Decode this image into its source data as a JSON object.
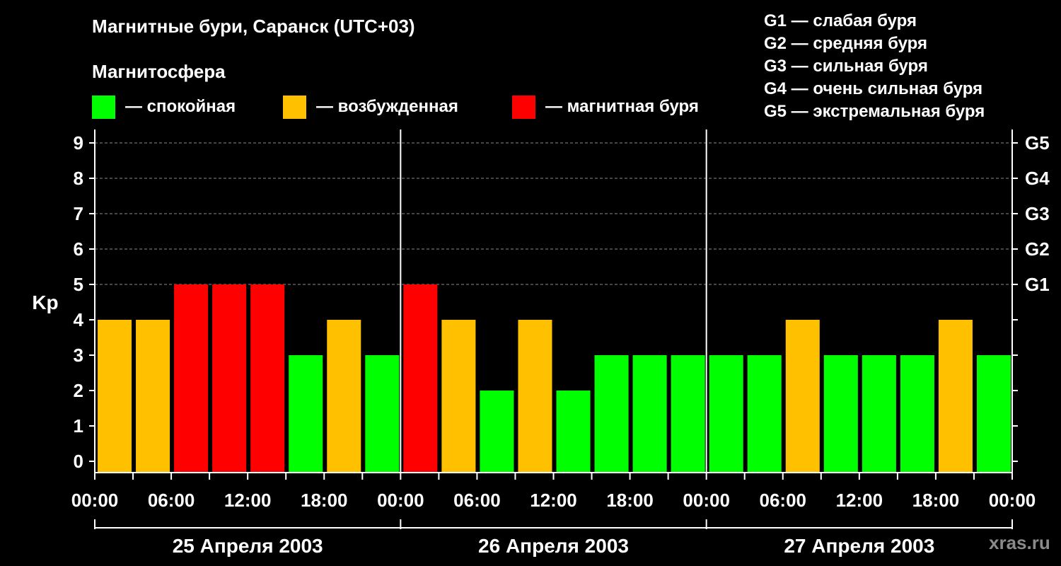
{
  "title": "Магнитные бури, Саранск (UTC+03)",
  "subtitle": "Магнитосфера",
  "legend": [
    {
      "label": "— спокойная",
      "color": "#00ff00"
    },
    {
      "label": "— возбужденная",
      "color": "#ffc000"
    },
    {
      "label": "— магнитная буря",
      "color": "#ff0000"
    }
  ],
  "g_levels": [
    "G1 — слабая буря",
    "G2 — средняя буря",
    "G3 — сильная буря",
    "G4 — очень сильная буря",
    "G5 — экстремальная буря"
  ],
  "watermark": "xras.ru",
  "colors": {
    "calm": "#00ff00",
    "excited": "#ffc000",
    "storm": "#ff0000",
    "background": "#000000"
  },
  "chart_data": {
    "type": "bar",
    "ylabel": "Kp",
    "ylim": [
      0,
      9
    ],
    "yticks": [
      "0",
      "1",
      "2",
      "3",
      "4",
      "5",
      "6",
      "7",
      "8",
      "9"
    ],
    "right_ticks": [
      {
        "value": 5,
        "label": "G1"
      },
      {
        "value": 6,
        "label": "G2"
      },
      {
        "value": 7,
        "label": "G3"
      },
      {
        "value": 8,
        "label": "G4"
      },
      {
        "value": 9,
        "label": "G5"
      }
    ],
    "grid": true,
    "x_tick_labels": [
      "00:00",
      "06:00",
      "12:00",
      "18:00",
      "00:00",
      "06:00",
      "12:00",
      "18:00",
      "00:00",
      "06:00",
      "12:00",
      "18:00",
      "00:00"
    ],
    "days": [
      "25 Апреля 2003",
      "26 Апреля 2003",
      "27 Апреля 2003"
    ],
    "bar_interval_hours": 3,
    "values": [
      4,
      4,
      5,
      5,
      5,
      3,
      4,
      3,
      5,
      4,
      2,
      4,
      2,
      3,
      3,
      3,
      3,
      3,
      4,
      3,
      3,
      3,
      4,
      3
    ],
    "bar_colors": [
      "#ffc000",
      "#ffc000",
      "#ff0000",
      "#ff0000",
      "#ff0000",
      "#00ff00",
      "#ffc000",
      "#00ff00",
      "#ff0000",
      "#ffc000",
      "#00ff00",
      "#ffc000",
      "#00ff00",
      "#00ff00",
      "#00ff00",
      "#00ff00",
      "#00ff00",
      "#00ff00",
      "#ffc000",
      "#00ff00",
      "#00ff00",
      "#00ff00",
      "#ffc000",
      "#00ff00"
    ]
  }
}
